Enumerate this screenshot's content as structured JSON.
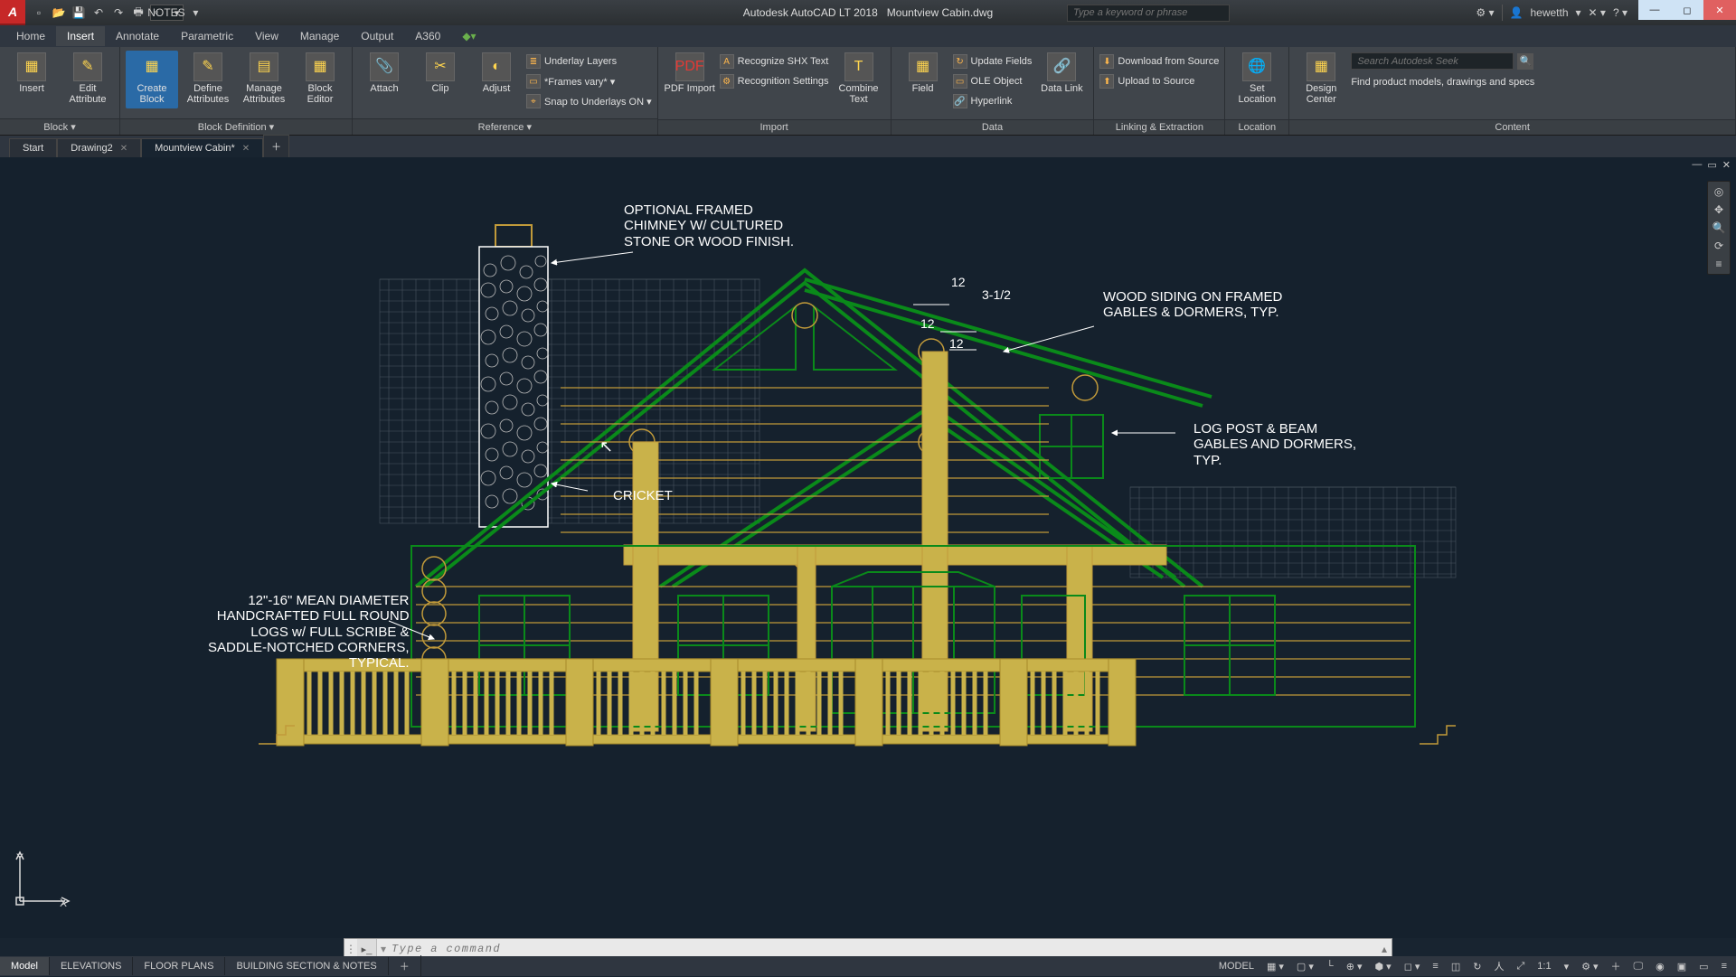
{
  "title": {
    "app": "Autodesk AutoCAD LT 2018",
    "file": "Mountview Cabin.dwg"
  },
  "qat": {
    "layer_dropdown": "NOTES"
  },
  "search": {
    "placeholder": "Type a keyword or phrase"
  },
  "user": {
    "name": "hewetth"
  },
  "menu": {
    "items": [
      "Home",
      "Insert",
      "Annotate",
      "Parametric",
      "View",
      "Manage",
      "Output",
      "A360"
    ],
    "active": "Insert"
  },
  "ribbon": {
    "block": {
      "title": "Block ▾",
      "insert": "Insert",
      "edit_attribute": "Edit Attribute"
    },
    "blockdef": {
      "title": "Block Definition ▾",
      "create": "Create Block",
      "define": "Define Attributes",
      "manage": "Manage Attributes",
      "editor": "Block Editor"
    },
    "reference": {
      "title": "Reference ▾",
      "attach": "Attach",
      "clip": "Clip",
      "adjust": "Adjust",
      "underlay": "Underlay Layers",
      "frames": "*Frames vary* ▾",
      "snap": "Snap to Underlays ON ▾"
    },
    "import": {
      "title": "Import",
      "pdf": "PDF Import",
      "shx": "Recognize SHX Text",
      "settings": "Recognition Settings",
      "combine": "Combine Text"
    },
    "data": {
      "title": "Data",
      "field": "Field",
      "update": "Update Fields",
      "ole": "OLE Object",
      "hyperlink": "Hyperlink",
      "link": "Data Link"
    },
    "linking": {
      "title": "Linking & Extraction",
      "download": "Download from Source",
      "upload": "Upload to Source"
    },
    "location": {
      "title": "Location",
      "set": "Set Location"
    },
    "content": {
      "title": "Content",
      "center": "Design Center",
      "seek_placeholder": "Search Autodesk Seek",
      "find": "Find product models, drawings and specs"
    }
  },
  "doctabs": {
    "start": "Start",
    "d2": "Drawing2",
    "cabin": "Mountview Cabin*"
  },
  "notes": {
    "chimney": "OPTIONAL FRAMED\nCHIMNEY W/ CULTURED\nSTONE OR WOOD FINISH.",
    "siding": "WOOD SIDING ON FRAMED\nGABLES & DORMERS, TYP.",
    "postbeam": "LOG POST & BEAM\nGABLES AND DORMERS,\nTYP.",
    "cricket": "CRICKET",
    "logs": "12\"-16\" MEAN DIAMETER\nHANDCRAFTED FULL ROUND\nLOGS w/ FULL SCRIBE &\nSADDLE-NOTCHED CORNERS,\nTYPICAL.",
    "dim12a": "12",
    "dim12b": "12",
    "dim12c": "12",
    "pitch": "3-1/2"
  },
  "cmd": {
    "placeholder": "Type a command"
  },
  "layouts": {
    "items": [
      "Model",
      "ELEVATIONS",
      "FLOOR PLANS",
      "BUILDING SECTION & NOTES"
    ],
    "active": "Model"
  },
  "status": {
    "model": "MODEL",
    "scale": "1:1"
  },
  "ucs": {
    "x": "X",
    "y": "Y"
  }
}
